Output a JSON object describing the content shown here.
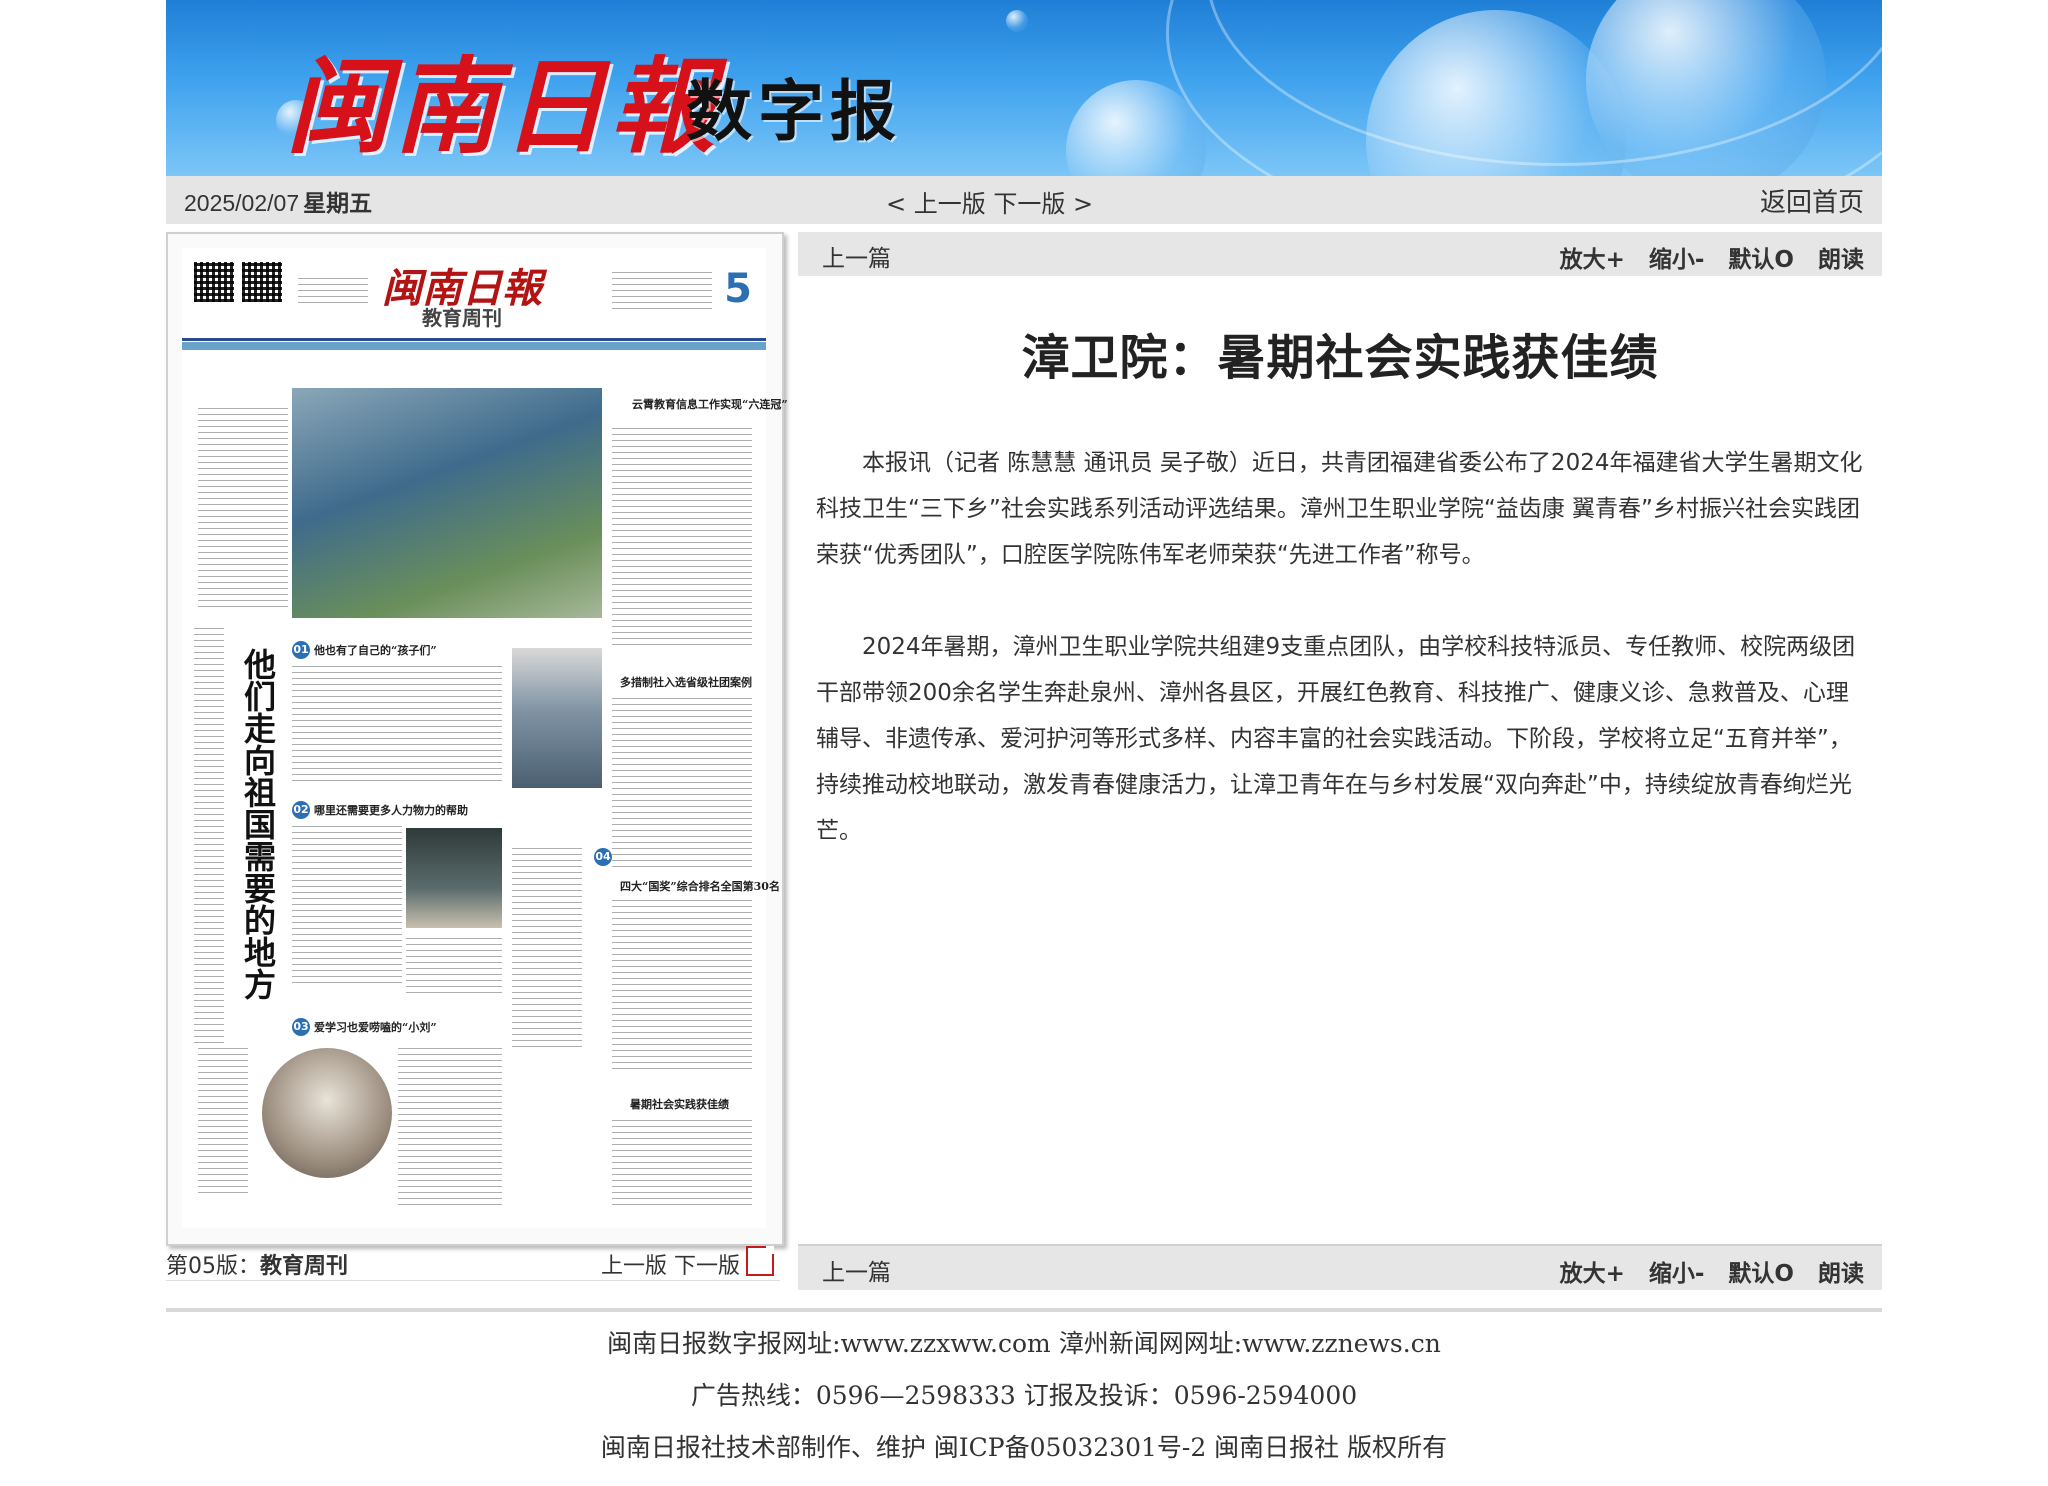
{
  "banner": {
    "logo": "闽南日報",
    "subtitle": "数字报"
  },
  "datebar": {
    "date": "2025/02/07",
    "weekday": "星期五",
    "prev_page": "< 上一版",
    "next_page": "下一版 >",
    "home": "返回首页"
  },
  "newspaper": {
    "masthead": "闽南日報",
    "edition_name": "教育周刊",
    "page_number": "5",
    "headline_vertical": "他们走向祖国需要的地方",
    "subheads": [
      "他也有了自己的“孩子们”",
      "哪里还需要更多人力物力的帮助",
      "爱学习也爱唠嗑的“小刘”",
      "云霄教育信息工作实现“六连冠”",
      "多措制社入选省级社团案例",
      "四大“国奖”综合排名全国第30名",
      "暑期社会实践获佳绩"
    ]
  },
  "page_caption": {
    "label": "第05版：",
    "name": "教育周刊",
    "prev": "上一版",
    "next": "下一版"
  },
  "toolbar": {
    "prev_article": "上一篇",
    "zoom_in": "放大+",
    "zoom_out": "缩小-",
    "default": "默认O",
    "read": "朗读"
  },
  "article": {
    "title": "漳卫院：暑期社会实践获佳绩",
    "paragraphs": [
      "本报讯（记者 陈慧慧 通讯员 吴子敬）近日，共青团福建省委公布了2024年福建省大学生暑期文化科技卫生“三下乡”社会实践系列活动评选结果。漳州卫生职业学院“益齿康 翼青春”乡村振兴社会实践团荣获“优秀团队”，口腔医学院陈伟军老师荣获“先进工作者”称号。",
      "2024年暑期，漳州卫生职业学院共组建9支重点团队，由学校科技特派员、专任教师、校院两级团干部带领200余名学生奔赴泉州、漳州各县区，开展红色教育、科技推广、健康义诊、急救普及、心理辅导、非遗传承、爱河护河等形式多样、内容丰富的社会实践活动。下阶段，学校将立足“五育并举”，持续推动校地联动，激发青春健康活力，让漳卫青年在与乡村发展“双向奔赴”中，持续绽放青春绚烂光芒。"
    ]
  },
  "footer": {
    "line1": "闽南日报数字报网址:www.zzxww.com 漳州新闻网网址:www.zznews.cn",
    "line2": "广告热线：0596—2598333 订报及投诉：0596-2594000",
    "line3": "闽南日报社技术部制作、维护 闽ICP备05032301号-2 闽南日报社 版权所有"
  },
  "colors": {
    "banner_blue": "#2f8fe2",
    "logo_red": "#d6111a",
    "bar_gray": "#e5e5e5"
  }
}
